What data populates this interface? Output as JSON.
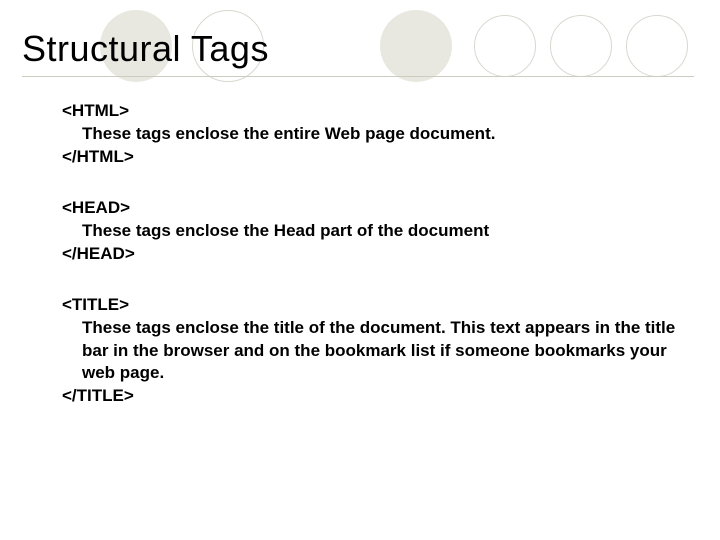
{
  "title": "Structural Tags",
  "blocks": [
    {
      "open": "<HTML>",
      "desc": "These tags enclose the entire Web page document.",
      "close": "</HTML>"
    },
    {
      "open": "<HEAD>",
      "desc": "These tags enclose the Head part of the document",
      "close": "</HEAD>"
    },
    {
      "open": "<TITLE>",
      "desc": "These tags enclose the title of the document.  This text appears in the title bar in the browser and on the bookmark list if someone bookmarks your web page.",
      "close": "</TITLE>"
    }
  ]
}
